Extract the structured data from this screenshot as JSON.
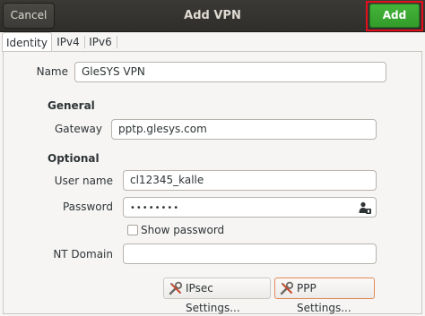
{
  "header": {
    "title": "Add VPN",
    "cancel_label": "Cancel",
    "add_label": "Add"
  },
  "tabs": [
    {
      "label": "Identity",
      "active": true
    },
    {
      "label": "IPv4",
      "active": false
    },
    {
      "label": "IPv6",
      "active": false
    }
  ],
  "form": {
    "name_label": "Name",
    "name_value": "GleSYS VPN",
    "general_heading": "General",
    "gateway_label": "Gateway",
    "gateway_value": "pptp.glesys.com",
    "optional_heading": "Optional",
    "username_label": "User name",
    "username_value": "cl12345_kalle",
    "password_label": "Password",
    "password_value": "••••••••",
    "show_password_label": "Show password",
    "show_password_checked": false,
    "ntdomain_label": "NT Domain",
    "ntdomain_value": ""
  },
  "buttons": {
    "ipsec_label": "IPsec Settings...",
    "ppp_label": "PPP Settings..."
  },
  "colors": {
    "headerbar": "#3a3935",
    "add_button": "#3aa832",
    "highlight": "#e3101c"
  },
  "icons": {
    "password_storage": "user-key-icon",
    "settings": "wrench-screwdriver-icon"
  }
}
